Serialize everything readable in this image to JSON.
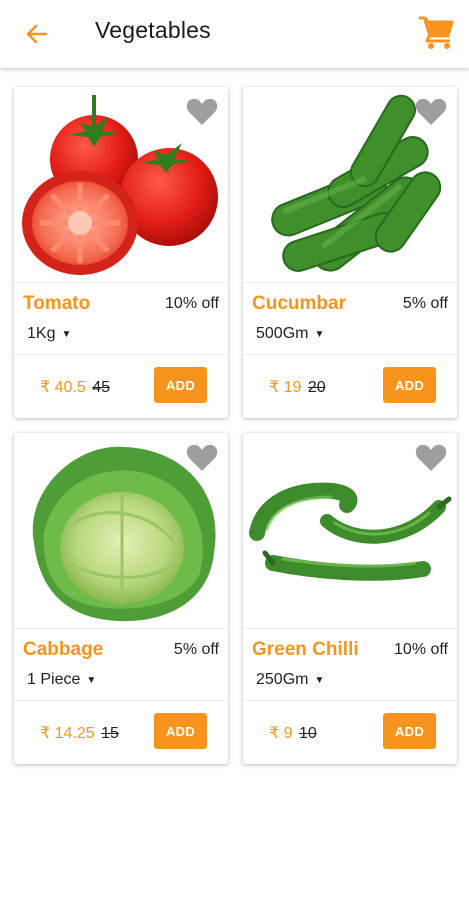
{
  "header": {
    "title": "Vegetables",
    "back_icon": "arrow-left-icon",
    "cart_icon": "cart-icon",
    "accent": "#f7941d"
  },
  "products": [
    {
      "name": "Tomato",
      "discount": "10% off",
      "quantity": "1Kg",
      "price": "₹ 40.5",
      "mrp": "45",
      "add_label": "ADD",
      "image": "tomato-image"
    },
    {
      "name": "Cucumbar",
      "discount": "5% off",
      "quantity": "500Gm",
      "price": "₹ 19",
      "mrp": "20",
      "add_label": "ADD",
      "image": "cucumber-image"
    },
    {
      "name": "Cabbage",
      "discount": "5% off",
      "quantity": "1 Piece",
      "price": "₹ 14.25",
      "mrp": "15",
      "add_label": "ADD",
      "image": "cabbage-image"
    },
    {
      "name": "Green Chilli",
      "discount": "10% off",
      "quantity": "250Gm",
      "price": "₹ 9",
      "mrp": "10",
      "add_label": "ADD",
      "image": "green-chilli-image"
    }
  ],
  "colors": {
    "accent": "#f7941d",
    "favorite_inactive": "#9e9e9e"
  }
}
